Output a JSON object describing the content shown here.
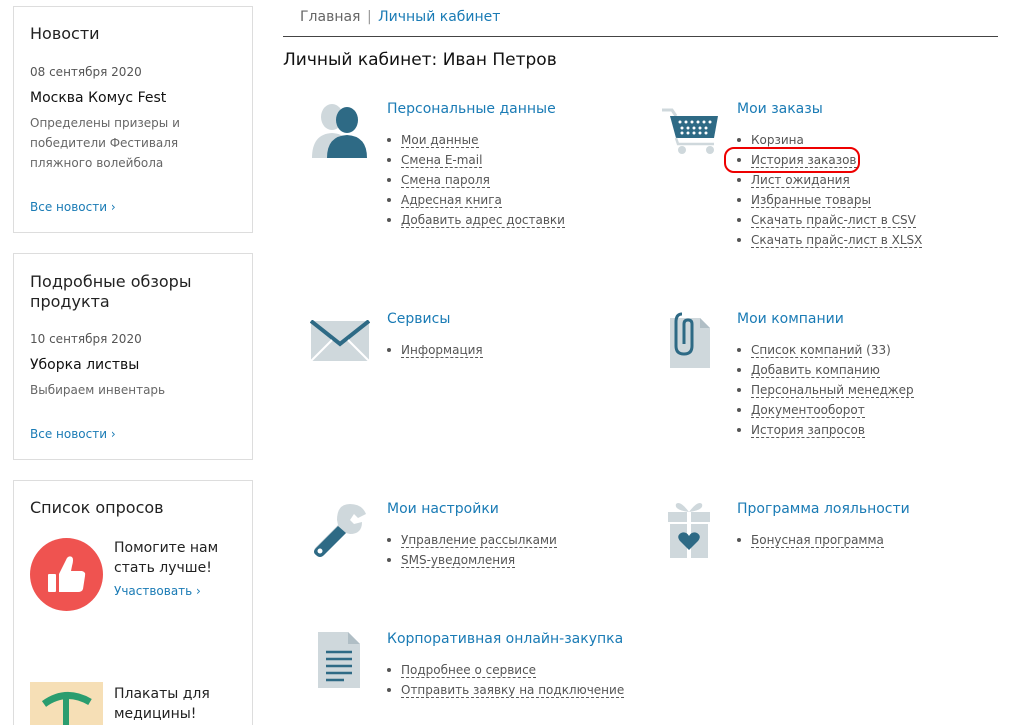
{
  "sidebar": {
    "news": {
      "title": "Новости",
      "date": "08 сентября 2020",
      "headline": "Москва Комус Fest",
      "text": "Определены призеры и победители Фестиваля пляжного волейбола",
      "link": "Все новости ›"
    },
    "reviews": {
      "title_line1": "Подробные обзоры",
      "title_line2": "продукта",
      "date": "10 сентября 2020",
      "headline": "Уборка листвы",
      "text": "Выбираем инвентарь",
      "link": "Все новости ›"
    },
    "polls": {
      "title": "Список опросов",
      "item1_line1": "Помогите нам",
      "item1_line2": "стать лучше!",
      "item1_link": "Участвовать ›",
      "item2_line1": "Плакаты для",
      "item2_line2": "медицины!"
    }
  },
  "breadcrumb": {
    "home": "Главная",
    "separator": "|",
    "current": "Личный кабинет"
  },
  "page_title": "Личный кабинет: Иван Петров",
  "sections": {
    "personal": {
      "title": "Персональные данные",
      "items": [
        "Мои данные",
        "Смена E-mail",
        "Смена пароля",
        "Адресная книга",
        "Добавить адрес доставки"
      ]
    },
    "orders": {
      "title": "Мои заказы",
      "items": [
        "Корзина",
        "История заказов",
        "Лист ожидания",
        "Избранные товары",
        "Скачать прайс-лист в CSV",
        "Скачать прайс-лист в XLSX"
      ]
    },
    "services": {
      "title": "Сервисы",
      "items": [
        "Информация"
      ]
    },
    "companies": {
      "title": "Мои компании",
      "items": [
        "Список компаний",
        "Добавить компанию",
        "Персональный менеджер",
        "Документооборот",
        "История запросов"
      ],
      "companies_count": "(33)"
    },
    "settings": {
      "title": "Мои настройки",
      "items": [
        "Управление рассылками",
        "SMS-уведомления"
      ]
    },
    "loyalty": {
      "title": "Программа лояльности",
      "items": [
        "Бонусная программа"
      ]
    },
    "corporate": {
      "title": "Корпоративная онлайн-закупка",
      "items": [
        "Подробнее о сервисе",
        "Отправить заявку на подключение"
      ]
    }
  },
  "colors": {
    "link": "#1a7bb5",
    "icon": "#2e6a85",
    "icon_light": "#cfd8dc",
    "highlight": "#ee0000",
    "poll_red": "#ef5350"
  }
}
